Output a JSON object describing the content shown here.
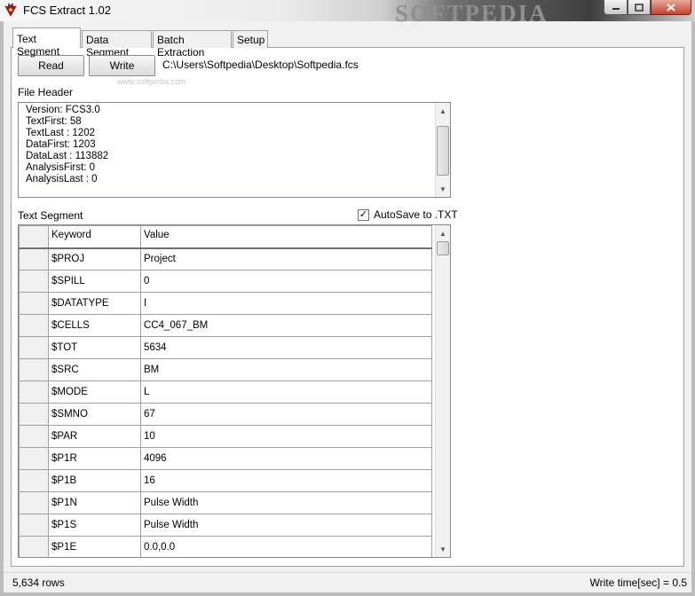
{
  "window": {
    "title": "FCS Extract 1.02",
    "watermark": "SOFTPEDIA"
  },
  "tabs": [
    {
      "label": "Text Segment"
    },
    {
      "label": "Data Segment"
    },
    {
      "label": "Batch Extraction"
    },
    {
      "label": "Setup"
    }
  ],
  "toolbar": {
    "read_label": "Read",
    "write_label": "Write",
    "file_path": "C:\\Users\\Softpedia\\Desktop\\Softpedia.fcs",
    "watermark_url": "www.softpedia.com"
  },
  "file_header": {
    "label": "File Header",
    "lines": [
      "Version:  FCS3.0",
      "TextFirst:  58",
      "TextLast :  1202",
      "DataFirst:  1203",
      "DataLast :  113882",
      "AnalysisFirst:  0",
      "AnalysisLast :  0"
    ]
  },
  "text_segment": {
    "label": "Text Segment",
    "autosave_label": "AutoSave to .TXT",
    "autosave_checked": "✓",
    "columns": [
      "Keyword",
      "Value"
    ],
    "rows": [
      [
        "$PROJ",
        "Project"
      ],
      [
        "$SPILL",
        "0"
      ],
      [
        "$DATATYPE",
        "I"
      ],
      [
        "$CELLS",
        "CC4_067_BM"
      ],
      [
        "$TOT",
        "5634"
      ],
      [
        "$SRC",
        "BM"
      ],
      [
        "$MODE",
        "L"
      ],
      [
        "$SMNO",
        "67"
      ],
      [
        "$PAR",
        "10"
      ],
      [
        "$P1R",
        "4096"
      ],
      [
        "$P1B",
        "16"
      ],
      [
        "$P1N",
        "Pulse Width"
      ],
      [
        "$P1S",
        "Pulse Width"
      ],
      [
        "$P1E",
        "0.0,0.0"
      ]
    ]
  },
  "status": {
    "rows": "5,634 rows",
    "write_time": "Write time[sec] = 0.5"
  }
}
